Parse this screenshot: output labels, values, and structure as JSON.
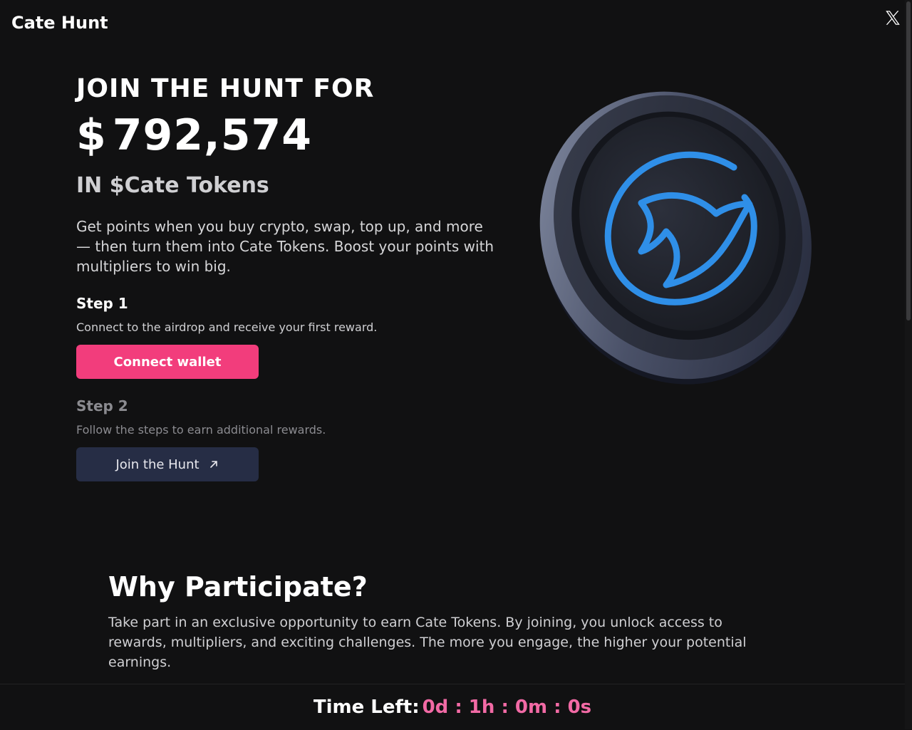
{
  "header": {
    "brand": "Cate Hunt",
    "x_icon": "x-logo-icon"
  },
  "hero": {
    "kicker": "JOIN THE HUNT FOR",
    "currency": "$",
    "amount": "792,574",
    "subtitle": "IN $Cate Tokens",
    "description": "Get points when you buy crypto, swap, top up, and more — then turn them into Cate Tokens. Boost your points with multipliers to win big."
  },
  "steps": [
    {
      "title": "Step 1",
      "text": "Connect to the airdrop and receive your first reward.",
      "button": "Connect wallet"
    },
    {
      "title": "Step 2",
      "text": "Follow the steps to earn additional rewards.",
      "button": "Join the Hunt"
    }
  ],
  "why": {
    "title": "Why Participate?",
    "text": "Take part in an exclusive opportunity to earn Cate Tokens. By joining, you unlock access to rewards, multipliers, and exciting challenges. The more you engage, the higher your potential earnings."
  },
  "footer": {
    "label": "Time Left:",
    "timer": "0d : 1h : 0m : 0s"
  },
  "colors": {
    "accent": "#f23d7c",
    "timer": "#f26aa5",
    "secondary_button": "#262d45",
    "coin_glow": "#2f8fe8",
    "background": "#111112"
  }
}
